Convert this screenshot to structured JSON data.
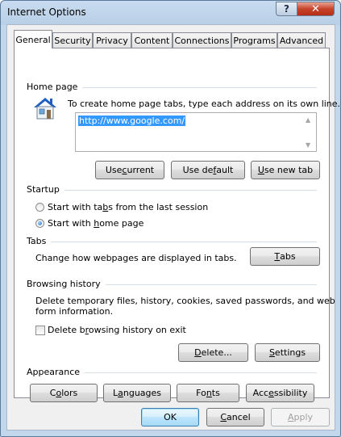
{
  "window": {
    "title": "Internet Options",
    "help_glyph": "?",
    "close_glyph": "✕"
  },
  "tabs": [
    {
      "label": "General"
    },
    {
      "label": "Security"
    },
    {
      "label": "Privacy"
    },
    {
      "label": "Content"
    },
    {
      "label": "Connections"
    },
    {
      "label": "Programs"
    },
    {
      "label": "Advanced"
    }
  ],
  "home_page": {
    "heading": "Home page",
    "description": "To create home page tabs, type each address on its own line.",
    "url_value": "http://www.google.com/",
    "use_current": {
      "pre": "Use ",
      "key": "c",
      "post": "urrent"
    },
    "use_default": {
      "pre": "Use de",
      "key": "f",
      "post": "ault"
    },
    "use_new_tab": {
      "pre": "",
      "key": "U",
      "post": "se new tab"
    }
  },
  "startup": {
    "heading": "Startup",
    "option1": {
      "pre": "Start with ta",
      "key": "b",
      "post": "s from the last session",
      "selected": false
    },
    "option2": {
      "pre": "Start with ",
      "key": "h",
      "post": "ome page",
      "selected": true
    }
  },
  "tabs_section": {
    "heading": "Tabs",
    "description": "Change how webpages are displayed in tabs.",
    "button": {
      "pre": "",
      "key": "T",
      "post": "abs"
    }
  },
  "history": {
    "heading": "Browsing history",
    "description_line1": "Delete temporary files, history, cookies, saved passwords, and web",
    "description_line2": "form information.",
    "checkbox": {
      "pre": "Delete b",
      "key": "r",
      "post": "owsing history on exit",
      "checked": false
    },
    "delete_button": {
      "pre": "",
      "key": "D",
      "post": "elete..."
    },
    "settings_button": {
      "pre": "",
      "key": "S",
      "post": "ettings"
    }
  },
  "appearance": {
    "heading": "Appearance",
    "colors": {
      "pre": "C",
      "key": "o",
      "post": "lors"
    },
    "languages": {
      "pre": "L",
      "key": "a",
      "post": "nguages"
    },
    "fonts": {
      "pre": "Fo",
      "key": "n",
      "post": "ts"
    },
    "accessibility": {
      "pre": "Acc",
      "key": "e",
      "post": "ssibility"
    }
  },
  "footer": {
    "ok": "OK",
    "cancel": {
      "pre": "",
      "key": "C",
      "post": "ancel"
    },
    "apply": {
      "pre": "",
      "key": "A",
      "post": "pply"
    }
  }
}
